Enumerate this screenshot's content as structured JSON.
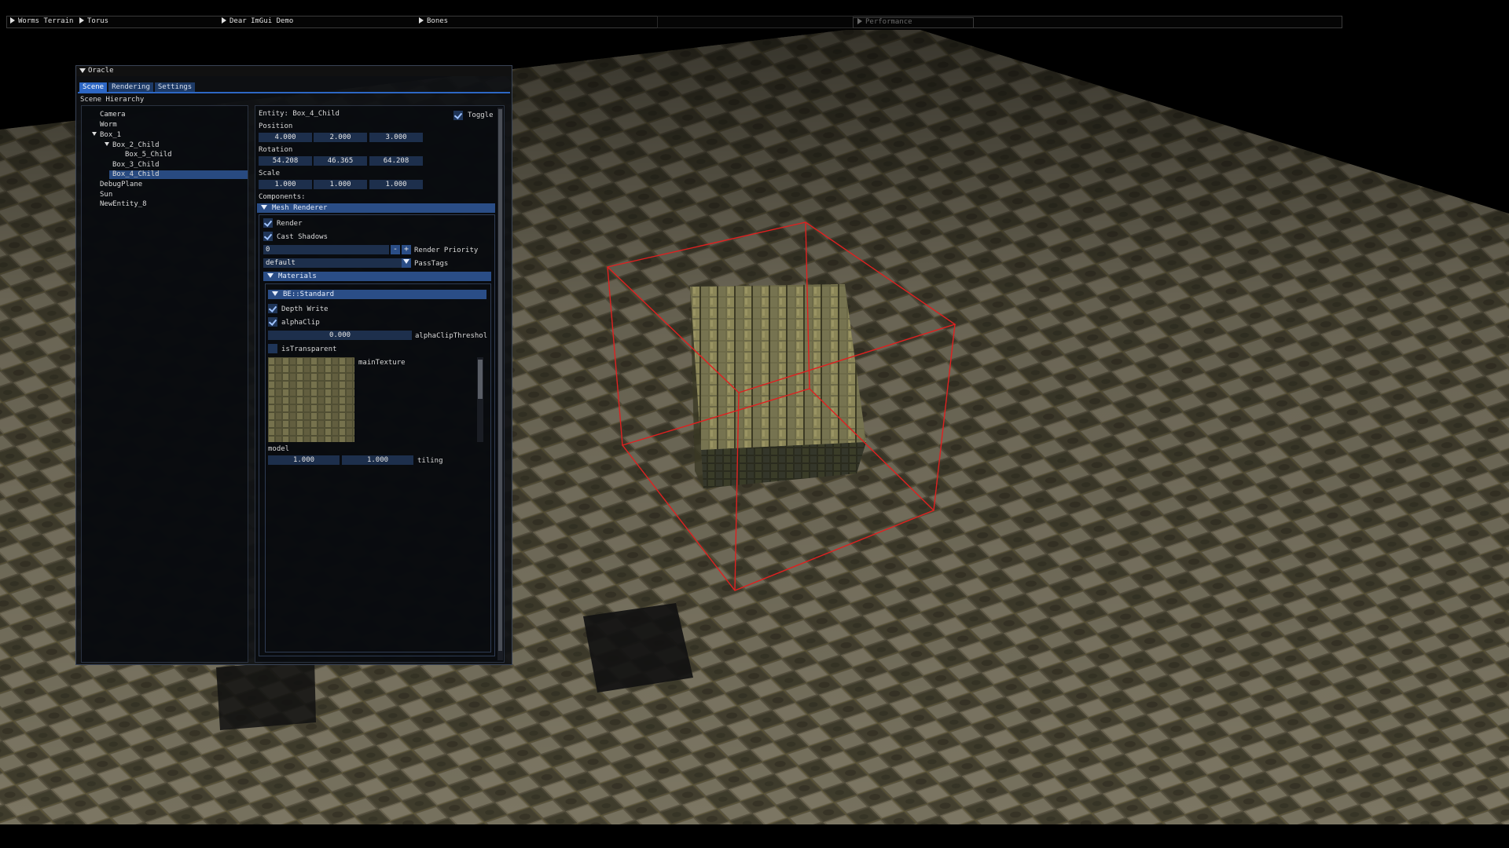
{
  "menubar": {
    "items": [
      {
        "label": "Worms Terrain"
      },
      {
        "label": "Torus"
      },
      {
        "label": "Dear ImGui Demo"
      },
      {
        "label": "Bones"
      },
      {
        "label": ""
      },
      {
        "label": "Performance"
      }
    ]
  },
  "oracle": {
    "title": "Oracle",
    "tabs": [
      "Scene",
      "Rendering",
      "Settings"
    ],
    "active_tab": "Scene",
    "hierarchy_label": "Scene Hierarchy",
    "hierarchy": {
      "nodes": [
        {
          "label": "Camera",
          "depth": 0,
          "open": false
        },
        {
          "label": "Worm",
          "depth": 0,
          "open": false
        },
        {
          "label": "Box_1",
          "depth": 0,
          "open": true
        },
        {
          "label": "Box_2_Child",
          "depth": 1,
          "open": true
        },
        {
          "label": "Box_5_Child",
          "depth": 2,
          "open": false
        },
        {
          "label": "Box_3_Child",
          "depth": 1,
          "open": false
        },
        {
          "label": "Box_4_Child",
          "depth": 1,
          "open": false,
          "selected": true
        },
        {
          "label": "DebugPlane",
          "depth": 0,
          "open": false
        },
        {
          "label": "Sun",
          "depth": 0,
          "open": false
        },
        {
          "label": "NewEntity_8",
          "depth": 0,
          "open": false
        }
      ]
    },
    "inspector": {
      "entity_label": "Entity: Box_4_Child",
      "toggle_label": "Toggle",
      "toggle_checked": true,
      "position_label": "Position",
      "position": [
        "4.000",
        "2.000",
        "3.000"
      ],
      "rotation_label": "Rotation",
      "rotation": [
        "54.208",
        "46.365",
        "64.208"
      ],
      "scale_label": "Scale",
      "scale": [
        "1.000",
        "1.000",
        "1.000"
      ],
      "components_label": "Components:",
      "mesh_renderer": {
        "header": "Mesh Renderer",
        "render_label": "Render",
        "render_checked": true,
        "cast_shadows_label": "Cast Shadows",
        "cast_shadows_checked": true,
        "render_priority_value": "0",
        "render_priority_label": "Render Priority",
        "minus_label": "-",
        "plus_label": "+",
        "pass_tags_value": "default",
        "pass_tags_label": "PassTags",
        "materials_header": "Materials",
        "material": {
          "header": "BE::Standard",
          "depth_write_label": "Depth Write",
          "depth_write_checked": true,
          "alpha_clip_label": "alphaClip",
          "alpha_clip_checked": true,
          "alpha_clip_threshold_value": "0.000",
          "alpha_clip_threshold_label": "alphaClipThreshol",
          "is_transparent_label": "isTransparent",
          "is_transparent_checked": false,
          "main_texture_label": "mainTexture",
          "model_label": "model",
          "tiling_values": [
            "1.000",
            "1.000"
          ],
          "tiling_label": "tiling"
        }
      }
    }
  },
  "colors": {
    "accent": "#2d67c4",
    "frame": "#1d2f4c",
    "header": "#2a4d86",
    "selection_box": "#e02020"
  }
}
